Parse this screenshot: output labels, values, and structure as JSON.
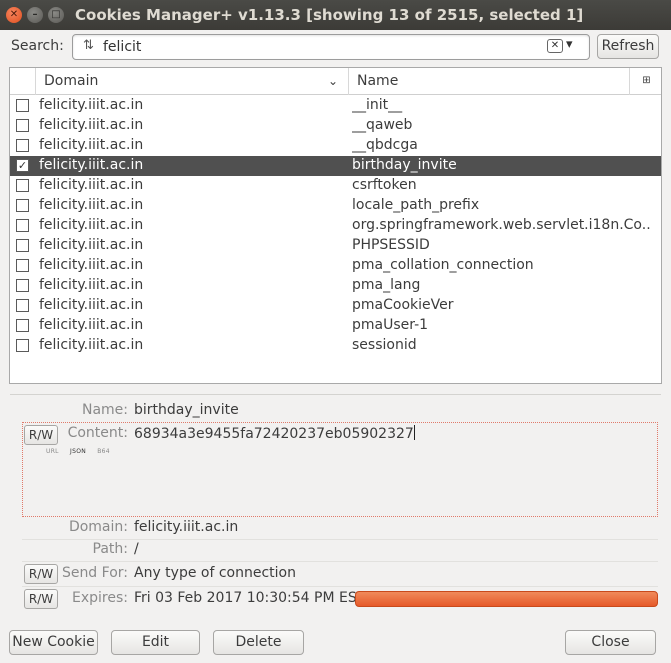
{
  "window": {
    "title": "Cookies Manager+ v1.13.3 [showing 13 of 2515, selected 1]"
  },
  "search": {
    "label": "Search:",
    "value": "felicit",
    "clear_glyph": "⌫"
  },
  "buttons": {
    "refresh": "Refresh",
    "new_cookie": "New Cookie",
    "edit": "Edit",
    "delete": "Delete",
    "close": "Close",
    "rw": "R/W"
  },
  "table": {
    "headers": {
      "domain": "Domain",
      "name": "Name"
    },
    "rows": [
      {
        "domain": "felicity.iiit.ac.in",
        "name": "__init__",
        "checked": false,
        "selected": false
      },
      {
        "domain": "felicity.iiit.ac.in",
        "name": "__qaweb",
        "checked": false,
        "selected": false
      },
      {
        "domain": "felicity.iiit.ac.in",
        "name": "__qbdcga",
        "checked": false,
        "selected": false
      },
      {
        "domain": "felicity.iiit.ac.in",
        "name": "birthday_invite",
        "checked": true,
        "selected": true
      },
      {
        "domain": "felicity.iiit.ac.in",
        "name": "csrftoken",
        "checked": false,
        "selected": false
      },
      {
        "domain": "felicity.iiit.ac.in",
        "name": "locale_path_prefix",
        "checked": false,
        "selected": false
      },
      {
        "domain": "felicity.iiit.ac.in",
        "name": "org.springframework.web.servlet.i18n.Co...",
        "checked": false,
        "selected": false
      },
      {
        "domain": "felicity.iiit.ac.in",
        "name": "PHPSESSID",
        "checked": false,
        "selected": false
      },
      {
        "domain": "felicity.iiit.ac.in",
        "name": "pma_collation_connection",
        "checked": false,
        "selected": false
      },
      {
        "domain": "felicity.iiit.ac.in",
        "name": "pma_lang",
        "checked": false,
        "selected": false
      },
      {
        "domain": "felicity.iiit.ac.in",
        "name": "pmaCookieVer",
        "checked": false,
        "selected": false
      },
      {
        "domain": "felicity.iiit.ac.in",
        "name": "pmaUser-1",
        "checked": false,
        "selected": false
      },
      {
        "domain": "felicity.iiit.ac.in",
        "name": "sessionid",
        "checked": false,
        "selected": false
      }
    ]
  },
  "details": {
    "name_label": "Name:",
    "name": "birthday_invite",
    "content_label": "Content:",
    "content": "68934a3e9455fa72420237eb05902327",
    "formats": [
      "URL",
      "JSON",
      "B64"
    ],
    "domain_label": "Domain:",
    "domain": "felicity.iiit.ac.in",
    "path_label": "Path:",
    "path": "/",
    "sendfor_label": "Send For:",
    "sendfor": "Any type of connection",
    "expires_label": "Expires:",
    "expires": "Fri 03 Feb 2017 10:30:54 PM EST"
  },
  "colors": {
    "selected_row": "#505050",
    "expires_bar": "#e65a2a",
    "titlebar": "#3c3b37"
  }
}
